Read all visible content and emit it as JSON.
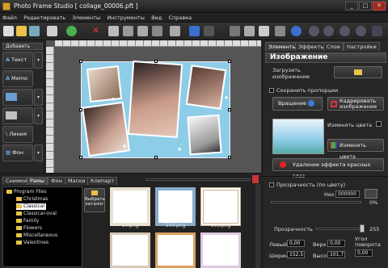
{
  "window": {
    "title": "Photo Frame Studio [ collage_00006.pft ]",
    "minimize": "_",
    "maximize": "□",
    "close": "✕"
  },
  "menu": [
    "Файл",
    "Редактировать",
    "Элементы",
    "Инструменты",
    "Вид",
    "Справка"
  ],
  "left_panel": {
    "header": "Добавить",
    "buttons": [
      {
        "label": "Текст",
        "icon": "A"
      },
      {
        "label": "Memo",
        "icon": "A"
      },
      {
        "label": "",
        "icon": ""
      },
      {
        "label": "",
        "icon": ""
      },
      {
        "label": "Линия",
        "icon": "\\"
      },
      {
        "label": "Фон",
        "icon": "▦"
      }
    ]
  },
  "right_panel": {
    "tabs": [
      "Элементы",
      "Эффекты",
      "Слои",
      "Настройки"
    ],
    "section_title": "Изображение",
    "load_image": "Загрузить изображение",
    "keep_proportions": "Сохранить пропорции",
    "rotate": "Вращение",
    "crop": "Кадрировать изображение",
    "change_color_label": "Изменять цвета",
    "change_color_btn": "Изменять цвета",
    "red_eye": "Удаление эффекта красных глаз",
    "transparency_label": "Прозрачность (по цвету)",
    "hex_label": "Hex",
    "hex_value": "000000",
    "transparency_pct": "0%",
    "opacity_label": "Прозрачность",
    "opacity_value": "255",
    "fields": {
      "left_label": "Левый",
      "left_value": "0,00",
      "top_label": "Верх",
      "top_value": "0,00",
      "angle_label": "Угол поворота",
      "angle_value": "0,00",
      "width_label": "Ширина",
      "width_value": "152,5",
      "height_label": "Высота",
      "height_value": "101,7"
    }
  },
  "bottom_panel": {
    "tabs": [
      "Снимки",
      "Рамы",
      "Фон",
      "Маски",
      "Клипарт"
    ],
    "active_tab": "Рамы",
    "choose_catalog": "Выбрать каталог",
    "tree": [
      "Program Files",
      "Christmas",
      "Classical",
      "Classical-oval",
      "Family",
      "Flowers",
      "Miscellaneous",
      "Valentines"
    ],
    "thumbs": [
      "10.png",
      "100.png",
      "106.png"
    ]
  }
}
